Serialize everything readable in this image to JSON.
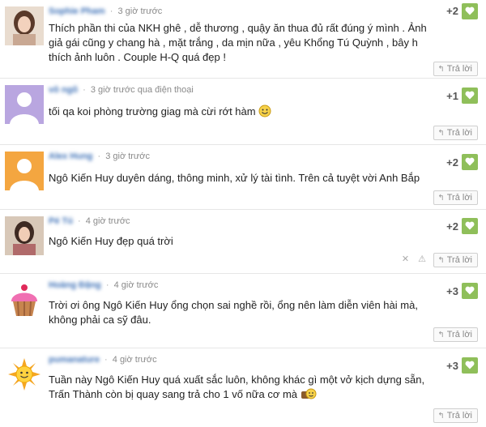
{
  "reply_label": "Trả lời",
  "comments": [
    {
      "author": "Sophie Pham",
      "time": "3 giờ trước",
      "via": "",
      "text": "Thích phần thi của NKH ghê , dễ thương , quậy ăn thua đủ rất đúng ý mình . Ảnh giả gái cũng y chang hà , mặt trắng , da mịn nữa , yêu Khổng Tú Quỳnh , bây h thích ảnh luôn . Couple H-Q quá đẹp !",
      "score": "+2",
      "avatar": "girl-photo"
    },
    {
      "author": "vô ngõ",
      "time": "3 giờ trước",
      "via": "qua điện thoại",
      "text": "tối qa koi phòng trường giag mà cừi rớt hàm",
      "score": "+1",
      "avatar": "default-purple"
    },
    {
      "author": "Alex Hung",
      "time": "3 giờ trước",
      "via": "",
      "text": "Ngô Kiến Huy duyên dáng, thông minh, xử lý tài tình. Trên cả tuyệt vời Anh Bắp",
      "score": "+2",
      "avatar": "default-orange"
    },
    {
      "author": "Pé Tú",
      "time": "4 giờ trước",
      "via": "",
      "text": "Ngô Kiến Huy đẹp quá trời",
      "score": "+2",
      "avatar": "girl-photo-2"
    },
    {
      "author": "Hoàng Đặng",
      "time": "4 giờ trước",
      "via": "",
      "text": "Trời ơi ông Ngô Kiến Huy ổng chọn sai nghề rồi, ổng nên làm diễn viên hài mà, không phải ca sỹ đâu.",
      "score": "+3",
      "avatar": "cupcake"
    },
    {
      "author": "pumanature",
      "time": "4 giờ trước",
      "via": "",
      "text": "Tuần này Ngô Kiến Huy quá xuất sắc luôn, không khác gì một vở kịch dựng sẵn, Trấn Thành còn bị quay sang trả cho 1 vố nữa cơ mà",
      "score": "+3",
      "avatar": "sun"
    }
  ],
  "colors": {
    "like_button": "#8fbf5a",
    "author_link": "#3b6fb6"
  }
}
